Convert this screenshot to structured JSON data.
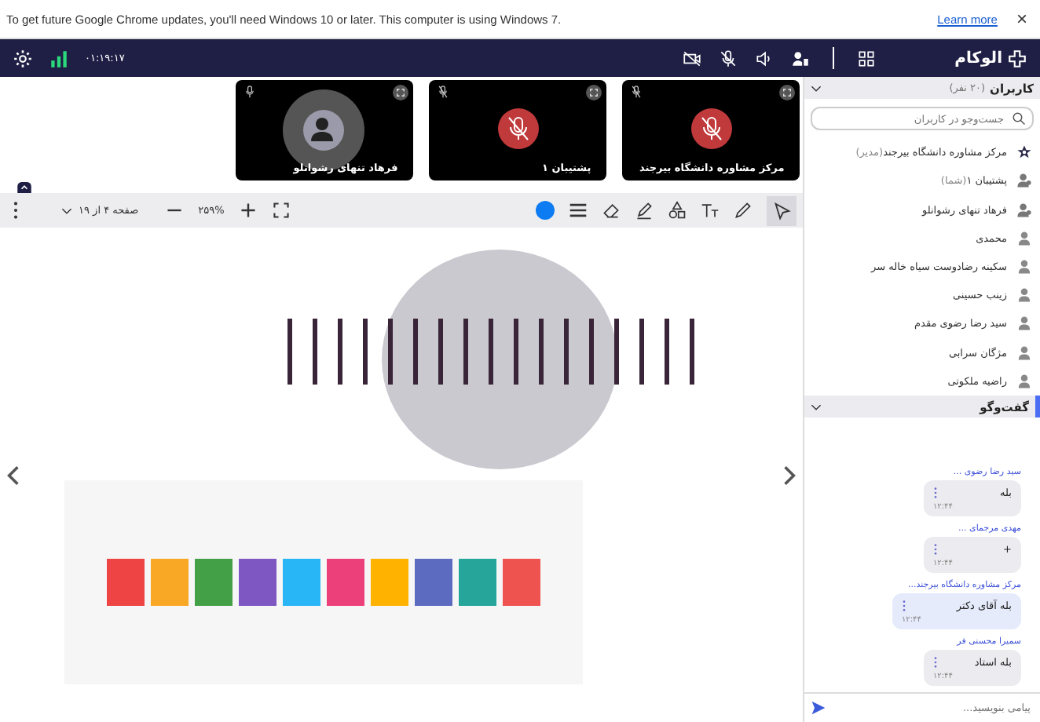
{
  "banner": {
    "message": "To get future Google Chrome updates, you'll need Windows 10 or later. This computer is using Windows 7.",
    "link": "Learn more",
    "close": "×"
  },
  "topbar": {
    "time": "۰۱:۱۹:۱۷",
    "logo": "الوکام"
  },
  "videos": [
    {
      "name": "مرکز مشاوره دانشگاه بیرجند",
      "muted": true,
      "kind": "muted"
    },
    {
      "name": "پشتیبان ۱",
      "muted": true,
      "kind": "muted"
    },
    {
      "name": "فرهاد تنهای رشوانلو",
      "muted": false,
      "kind": "avatar"
    }
  ],
  "toolbar": {
    "page": "صفحه ۴ از ۱۹",
    "zoom": "۲۵۹%",
    "pen": {
      "color": "#0d7cf2"
    }
  },
  "users": {
    "title": "کاربران",
    "count": "(۲۰ نفر)",
    "search_placeholder": "جست‌وجو در کاربران",
    "items": [
      {
        "name": "مرکز مشاوره دانشگاه بیرجند",
        "tag": "(مدیر)",
        "kind": "moderator"
      },
      {
        "name": "پشتیبان ۱",
        "tag": "(شما)",
        "kind": "presenter"
      },
      {
        "name": "فرهاد تنهای رشوانلو",
        "kind": "presenter"
      },
      {
        "name": "محمدی",
        "kind": "user"
      },
      {
        "name": "سکینه رضادوست سیاه خاله سر",
        "kind": "user"
      },
      {
        "name": "زینب حسینی",
        "kind": "user"
      },
      {
        "name": "سید رضا رضوی مقدم",
        "kind": "user"
      },
      {
        "name": "مژگان سرابی",
        "kind": "user"
      },
      {
        "name": "راضیه ملکوتی",
        "kind": "user"
      }
    ]
  },
  "chat": {
    "title": "گفت‌وگو",
    "placeholder": "پیامی بنویسید...",
    "messages": [
      {
        "sender": "سید رضا رضوی ...",
        "text": "بله",
        "time": "۱۲:۴۴",
        "own": false
      },
      {
        "sender": "مهدی مرجمای ...",
        "text": "+",
        "time": "۱۲:۴۴",
        "own": false
      },
      {
        "sender": "مرکز مشاوره دانشگاه بیرجند...",
        "text": "بله آقای دکتر",
        "time": "۱۲:۴۴",
        "own": true
      },
      {
        "sender": "سمیرا محسنی فر",
        "text": "بله استاد",
        "time": "۱۲:۴۴",
        "own": false
      }
    ]
  }
}
